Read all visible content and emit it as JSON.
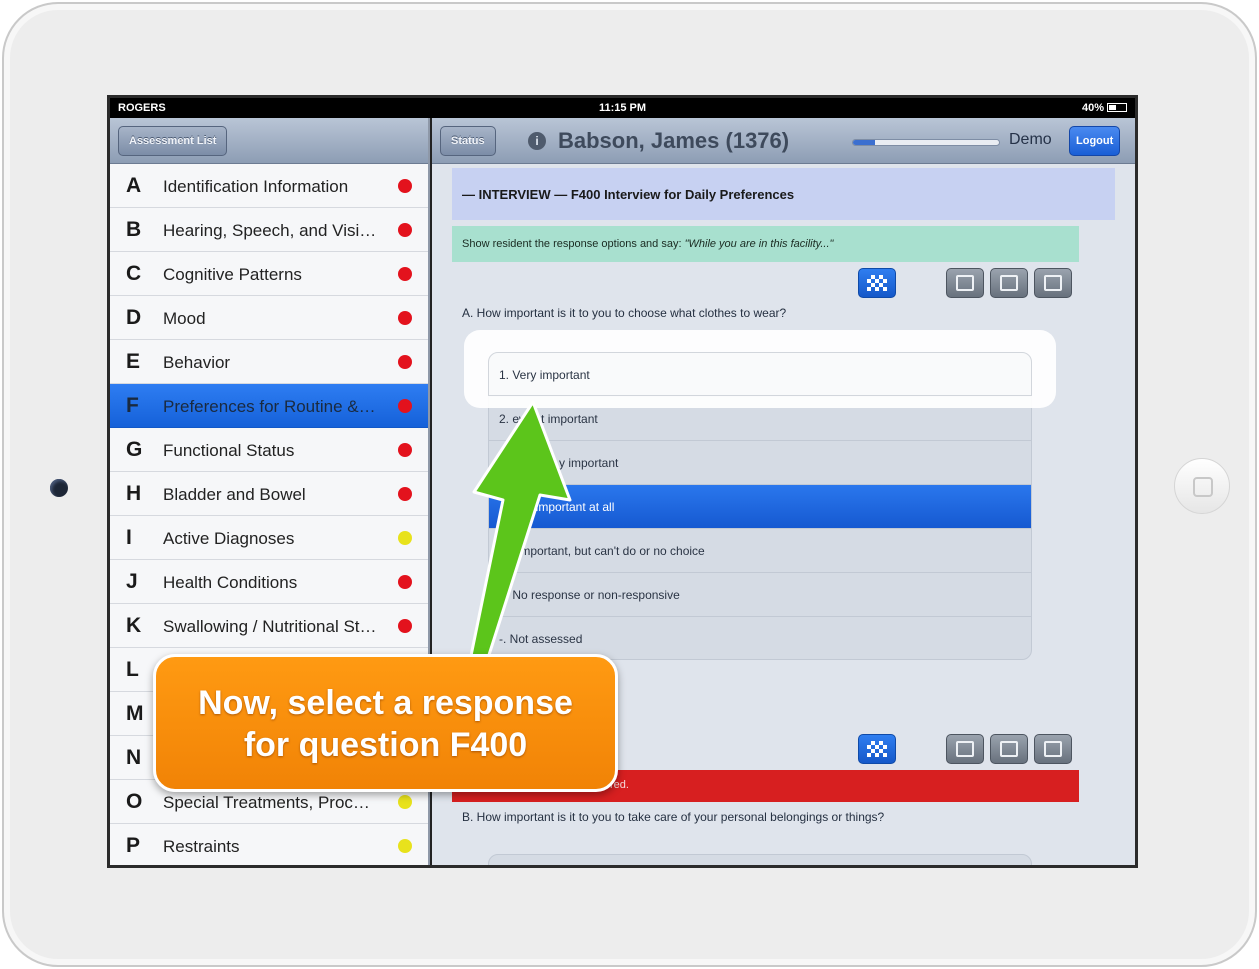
{
  "statusbar": {
    "carrier": "ROGERS",
    "time": "11:15 PM",
    "battery": "40%"
  },
  "left_nav": {
    "button": "Assessment List"
  },
  "sections": [
    {
      "letter": "A",
      "title": "Identification Information",
      "status": "red",
      "color": "#e3121d"
    },
    {
      "letter": "B",
      "title": "Hearing, Speech, and Visi…",
      "status": "red",
      "color": "#e3121d"
    },
    {
      "letter": "C",
      "title": "Cognitive Patterns",
      "status": "red",
      "color": "#e3121d"
    },
    {
      "letter": "D",
      "title": "Mood",
      "status": "red",
      "color": "#e3121d"
    },
    {
      "letter": "E",
      "title": "Behavior",
      "status": "red",
      "color": "#e3121d"
    },
    {
      "letter": "F",
      "title": "Preferences for Routine &…",
      "status": "red",
      "color": "#e3121d",
      "selected": true
    },
    {
      "letter": "G",
      "title": "Functional Status",
      "status": "red",
      "color": "#e3121d"
    },
    {
      "letter": "H",
      "title": "Bladder and Bowel",
      "status": "red",
      "color": "#e3121d"
    },
    {
      "letter": "I",
      "title": "Active Diagnoses",
      "status": "yellow",
      "color": "#e8e21c"
    },
    {
      "letter": "J",
      "title": "Health Conditions",
      "status": "red",
      "color": "#e3121d"
    },
    {
      "letter": "K",
      "title": "Swallowing / Nutritional St…",
      "status": "red",
      "color": "#e3121d"
    },
    {
      "letter": "L",
      "title": "",
      "status": "none",
      "color": ""
    },
    {
      "letter": "M",
      "title": "",
      "status": "none",
      "color": ""
    },
    {
      "letter": "N",
      "title": "",
      "status": "none",
      "color": ""
    },
    {
      "letter": "O",
      "title": "Special Treatments, Proc…",
      "status": "yellow",
      "color": "#e8e21c"
    },
    {
      "letter": "P",
      "title": "Restraints",
      "status": "yellow",
      "color": "#e8e21c"
    }
  ],
  "header": {
    "status_button": "Status",
    "info_icon": "i",
    "patient": "Babson, James (1376)",
    "progress": 0.15,
    "user": "Demo",
    "logout": "Logout"
  },
  "interview": {
    "section_title": "— INTERVIEW — F400 Interview for Daily Preferences",
    "instruction_prefix": "Show resident the response options and say: ",
    "instruction_quote": "\"While you are in this facility...\"",
    "question_a": "A.  How important is it to you to choose what clothes to wear?",
    "answers": [
      "1. Very important",
      "2. Somewhat important",
      "3. Not very important",
      "4. Not important at all",
      "5. Important, but can't do or no choice",
      "9. No response or non-responsive",
      "-. Not assessed"
    ],
    "answers_visible": [
      "1. Very important",
      "2. ewhat important",
      "y important",
      "t important at all",
      "Important, but can't do or no choice",
      "9. No response or non-responsive",
      "-. Not assessed"
    ],
    "selected_answer_index": 3,
    "red_bar_text": "red.",
    "question_b": "B.  How important is it to you to take care of your personal belongings or things?"
  },
  "callout": {
    "line1": "Now, select a response",
    "line2": "for question F400"
  },
  "colors": {
    "accent": "#1e6ae0",
    "callout": "#f58a0b",
    "arrow": "#5cc51b",
    "required": "#d71f20"
  }
}
